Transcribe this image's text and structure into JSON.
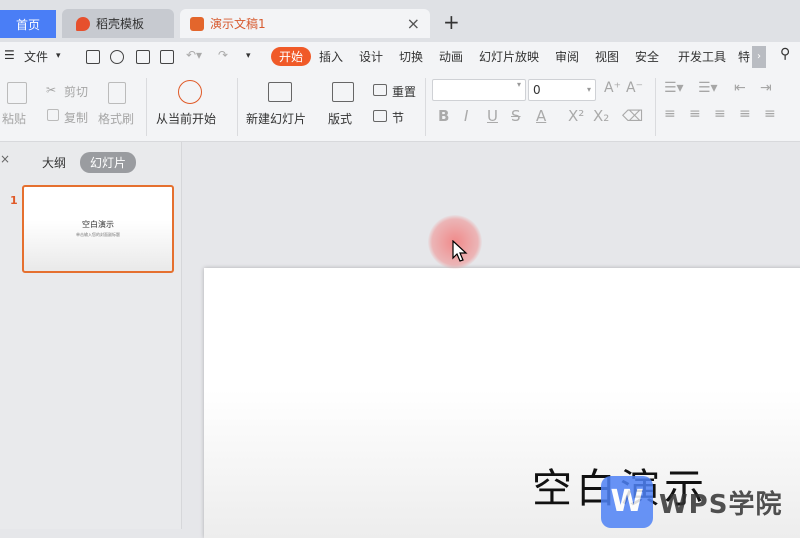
{
  "tabs": {
    "home": "首页",
    "templates": "稻壳模板",
    "document": "演示文稿1",
    "close": "×",
    "add": "+"
  },
  "menu": {
    "file": "文件",
    "items": [
      "开始",
      "插入",
      "设计",
      "切换",
      "动画",
      "幻灯片放映",
      "审阅",
      "视图",
      "安全",
      "开发工具",
      "特"
    ]
  },
  "ribbon": {
    "paste": "粘贴",
    "cut": "剪切",
    "copy": "复制",
    "format_painter": "格式刷",
    "play_from_current": "从当前开始",
    "new_slide": "新建幻灯片",
    "layout": "版式",
    "reset": "重置",
    "section": "节",
    "font_size": "0"
  },
  "pane": {
    "outline": "大纲",
    "slides": "幻灯片",
    "slide_number": "1",
    "thumb_title": "空白演示",
    "thumb_subtitle": "单击输入您的封面副标题"
  },
  "slide": {
    "title": "空白演示"
  },
  "watermark": {
    "logo": "W",
    "text": "WPS学院"
  },
  "colors": {
    "accent": "#f05a28",
    "home_tab": "#4a7ef6",
    "selection": "#e5702f"
  }
}
